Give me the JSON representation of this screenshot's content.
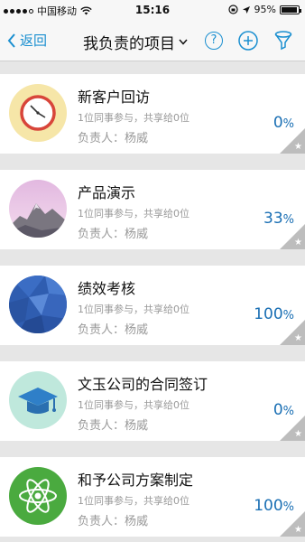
{
  "status_bar": {
    "carrier": "中国移动",
    "time": "15:16",
    "battery": "95%",
    "battery_level": 0.95
  },
  "nav": {
    "back_label": "返回",
    "title": "我负责的项目",
    "help_label": "?"
  },
  "projects": [
    {
      "title": "新客户回访",
      "sub": "1位同事参与，共享给0位",
      "owner": "负责人：杨威",
      "percent_value": "0",
      "percent_sign": "%",
      "icon": "clock-icon"
    },
    {
      "title": "产品演示",
      "sub": "1位同事参与，共享给0位",
      "owner": "负责人：杨威",
      "percent_value": "33",
      "percent_sign": "%",
      "icon": "mountain-icon"
    },
    {
      "title": "绩效考核",
      "sub": "1位同事参与，共享给0位",
      "owner": "负责人：杨威",
      "percent_value": "100",
      "percent_sign": "%",
      "icon": "polygon-sphere-icon"
    },
    {
      "title": "文玉公司的合同签订",
      "sub": "1位同事参与，共享给0位",
      "owner": "负责人：杨威",
      "percent_value": "0",
      "percent_sign": "%",
      "icon": "graduation-cap-icon"
    },
    {
      "title": "和予公司方案制定",
      "sub": "1位同事参与，共享给0位",
      "owner": "负责人：杨威",
      "percent_value": "100",
      "percent_sign": "%",
      "icon": "atom-icon"
    }
  ],
  "colors": {
    "accent": "#1a8fd0",
    "percent": "#1a6fb4",
    "corner": "#bdbdbd"
  }
}
